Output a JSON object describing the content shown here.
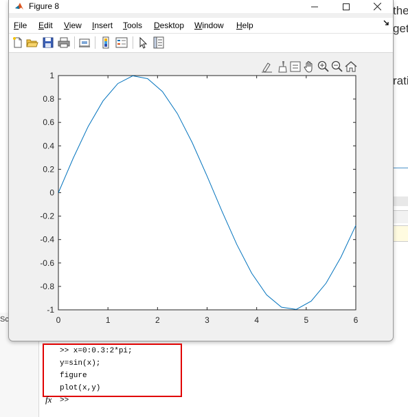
{
  "window": {
    "title": "Figure 8",
    "menu": [
      "File",
      "Edit",
      "View",
      "Insert",
      "Tools",
      "Desktop",
      "Window",
      "Help"
    ],
    "controls": [
      "minimize",
      "maximize",
      "close"
    ]
  },
  "toolbar": {
    "icons": [
      "new-figure-icon",
      "open-file-icon",
      "save-icon",
      "print-icon",
      "link-plot-icon",
      "insert-colorbar-icon",
      "insert-legend-icon",
      "edit-plot-icon",
      "property-inspector-icon"
    ]
  },
  "axes_toolbar": {
    "icons": [
      "data-tips-icon",
      "brush-icon",
      "restore-view-icon",
      "pan-hand-icon",
      "zoom-in-icon",
      "zoom-out-icon",
      "home-icon"
    ]
  },
  "chart_data": {
    "type": "line",
    "x": [
      0,
      0.3,
      0.6,
      0.9,
      1.2,
      1.5,
      1.8,
      2.1,
      2.4,
      2.7,
      3.0,
      3.3,
      3.6,
      3.9,
      4.2,
      4.5,
      4.8,
      5.1,
      5.4,
      5.7,
      6.0
    ],
    "series": [
      {
        "values": [
          0,
          0.2955,
          0.5646,
          0.7833,
          0.932,
          0.9975,
          0.9738,
          0.8632,
          0.6755,
          0.4274,
          0.1411,
          -0.1577,
          -0.4425,
          -0.6878,
          -0.8716,
          -0.9775,
          -0.9962,
          -0.9258,
          -0.7728,
          -0.5507,
          -0.2794
        ],
        "color": "#0072bd"
      }
    ],
    "xlim": [
      0,
      6
    ],
    "ylim": [
      -1,
      1
    ],
    "xticks": [
      "0",
      "1",
      "2",
      "3",
      "4",
      "5",
      "6"
    ],
    "yticks": [
      "1",
      "0.8",
      "0.6",
      "0.4",
      "0.2",
      "0",
      "-0.2",
      "-0.4",
      "-0.6",
      "-0.8",
      "-1"
    ],
    "grid": false,
    "title": "",
    "xlabel": "",
    "ylabel": ""
  },
  "command_window": {
    "lines": [
      ">> x=0:0.3:2*pi;",
      "y=sin(x);",
      "figure",
      "plot(x,y)"
    ],
    "prompt": ">>",
    "fx_label": "fx"
  },
  "background": {
    "right_snippets": [
      "the",
      "get",
      "rati"
    ],
    "left_snippet": "Sc"
  }
}
